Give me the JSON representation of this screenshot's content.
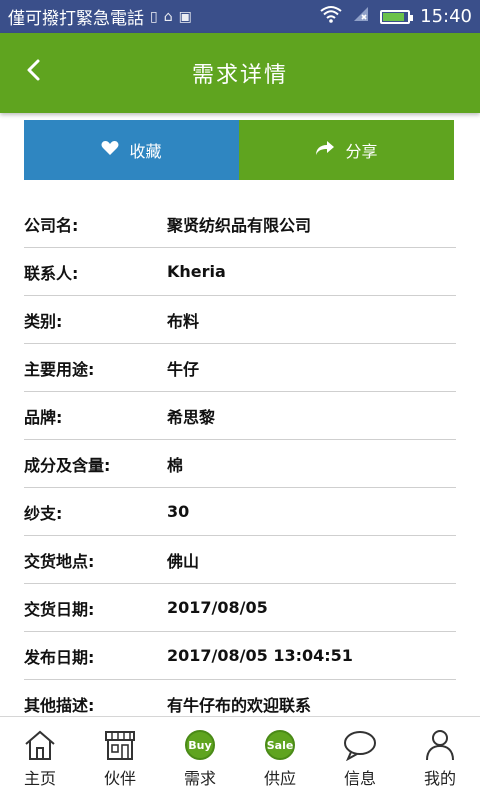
{
  "status_bar": {
    "carrier_text": "僅可撥打緊急電話",
    "time": "15:40"
  },
  "app_bar": {
    "title": "需求详情",
    "back_icon": "chevron-left-icon"
  },
  "actions": {
    "favorite_label": "收藏",
    "share_label": "分享",
    "favorite_color": "#2f86c1",
    "share_color": "#5fa41f"
  },
  "details": [
    {
      "label": "公司名:",
      "value": "聚贤纺织品有限公司"
    },
    {
      "label": "联系人:",
      "value": "Kheria"
    },
    {
      "label": "类别:",
      "value": "布料"
    },
    {
      "label": "主要用途:",
      "value": "牛仔"
    },
    {
      "label": "品牌:",
      "value": "希思黎"
    },
    {
      "label": "成分及含量:",
      "value": "棉"
    },
    {
      "label": "纱支:",
      "value": "30"
    },
    {
      "label": "交货地点:",
      "value": "佛山"
    },
    {
      "label": "交货日期:",
      "value": "2017/08/05"
    },
    {
      "label": "发布日期:",
      "value": "2017/08/05 13:04:51"
    },
    {
      "label": "其他描述:",
      "value": "有牛仔布的欢迎联系"
    }
  ],
  "bottom_nav": [
    {
      "label": "主页",
      "icon": "home-icon"
    },
    {
      "label": "伙伴",
      "icon": "storefront-icon"
    },
    {
      "label": "需求",
      "icon": "buy-badge-icon",
      "badge_text": "Buy"
    },
    {
      "label": "供应",
      "icon": "sale-badge-icon",
      "badge_text": "Sale"
    },
    {
      "label": "信息",
      "icon": "chat-bubble-icon"
    },
    {
      "label": "我的",
      "icon": "user-icon"
    }
  ],
  "theme": {
    "primary_green": "#5fa41f",
    "status_bar_blue": "#3a4f8a"
  }
}
